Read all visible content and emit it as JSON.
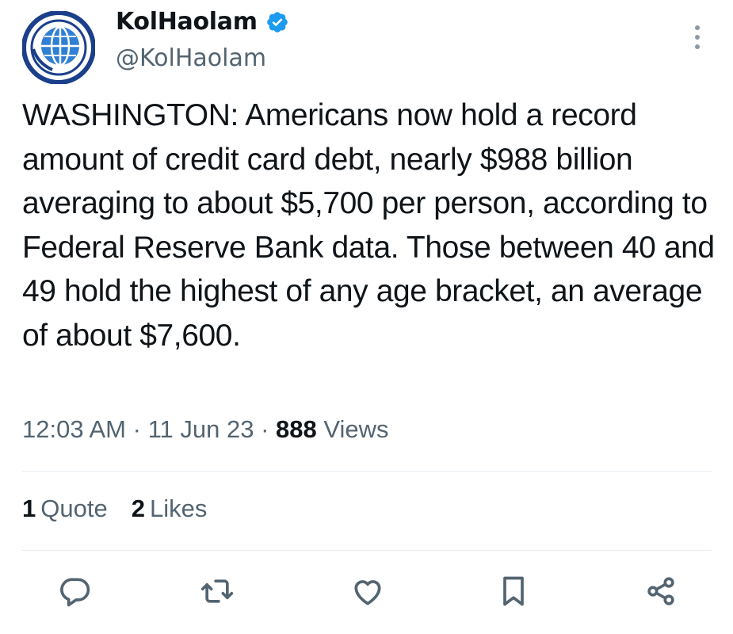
{
  "author": {
    "name": "KolHaolam",
    "handle": "@KolHaolam",
    "verified": true,
    "verified_color": "#1d9bf0",
    "avatar_colors": {
      "ring": "#1b3f8b",
      "globe": "#2f7fd3"
    }
  },
  "tweet": {
    "text": "WASHINGTON: Americans now hold a record amount of credit card debt, nearly $988 billion averaging to about $5,700 per person, according to Federal Reserve Bank data. Those between 40 and 49 hold the highest of any age bracket, an average of about $7,600.",
    "time": "12:03 AM",
    "date": "11 Jun 23",
    "separator": "·",
    "views_count": "888",
    "views_label": "Views"
  },
  "stats": {
    "quotes_count": "1",
    "quotes_label": "Quote",
    "likes_count": "2",
    "likes_label": "Likes"
  },
  "actions": [
    "reply-icon",
    "retweet-icon",
    "like-icon",
    "bookmark-icon",
    "share-icon"
  ],
  "colors": {
    "text": "#0f1419",
    "secondary": "#536471",
    "divider": "#e6ecf0"
  }
}
